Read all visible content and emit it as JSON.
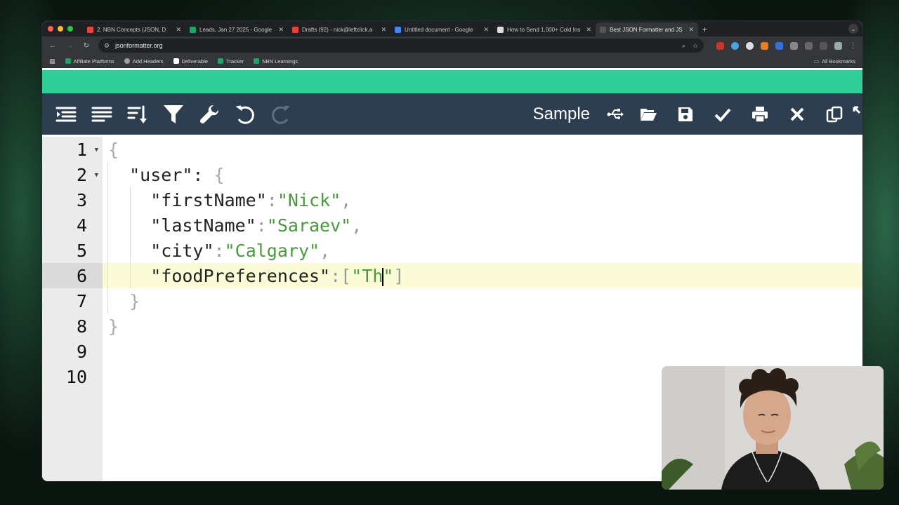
{
  "browser": {
    "tabs": [
      {
        "title": "2. NBN Concepts (JSON, D",
        "color": "#e8453c"
      },
      {
        "title": "Leads, Jan 27 2025 - Google",
        "color": "#1fa463"
      },
      {
        "title": "Drafts (92) - nick@leftclick.a",
        "color": "#ea4335"
      },
      {
        "title": "Untitled document - Google",
        "color": "#4285f4"
      },
      {
        "title": "How to Send 1,000+ Cold Ins",
        "color": "#dddddd"
      },
      {
        "title": "Best JSON Formatter and JS",
        "color": "#555555"
      }
    ],
    "url": "jsonformatter.org",
    "bookmarks": [
      {
        "label": "Affiliate Platforms",
        "color": "#1fa463"
      },
      {
        "label": "Add Headers",
        "color": "#9e9e9e"
      },
      {
        "label": "Deliverable",
        "color": "#ffffff"
      },
      {
        "label": "Tracker",
        "color": "#1fa463"
      },
      {
        "label": "NBN Learnings",
        "color": "#1fa463"
      }
    ],
    "all_bookmarks": "All Bookmarks"
  },
  "toolbar": {
    "sample_label": "Sample"
  },
  "editor": {
    "line_numbers": [
      "1",
      "2",
      "3",
      "4",
      "5",
      "6",
      "7",
      "8",
      "9",
      "10"
    ],
    "lines": {
      "l1": {
        "brace": "{"
      },
      "l2": {
        "key": "\"user\"",
        "colon": ": ",
        "brace": "{"
      },
      "l3": {
        "key": "\"firstName\"",
        "colon": ":",
        "value": "\"Nick\"",
        "comma": ","
      },
      "l4": {
        "key": "\"lastName\"",
        "colon": ":",
        "value": "\"Saraev\"",
        "comma": ","
      },
      "l5": {
        "key": "\"city\"",
        "colon": ":",
        "value": "\"Calgary\"",
        "comma": ","
      },
      "l6": {
        "key": "\"foodPreferences\"",
        "colon": ":",
        "open": "[",
        "value_before_cursor": "\"Th",
        "value_after_cursor": "\"",
        "close": "]"
      },
      "l7": {
        "brace": "}"
      },
      "l8": {
        "brace": "}"
      }
    },
    "active_line": 6
  },
  "colors": {
    "green_bar": "#2fcd98",
    "toolbar_bg": "#2c3e50",
    "string": "#4a9a3c",
    "active_line": "#fbfbd7"
  }
}
